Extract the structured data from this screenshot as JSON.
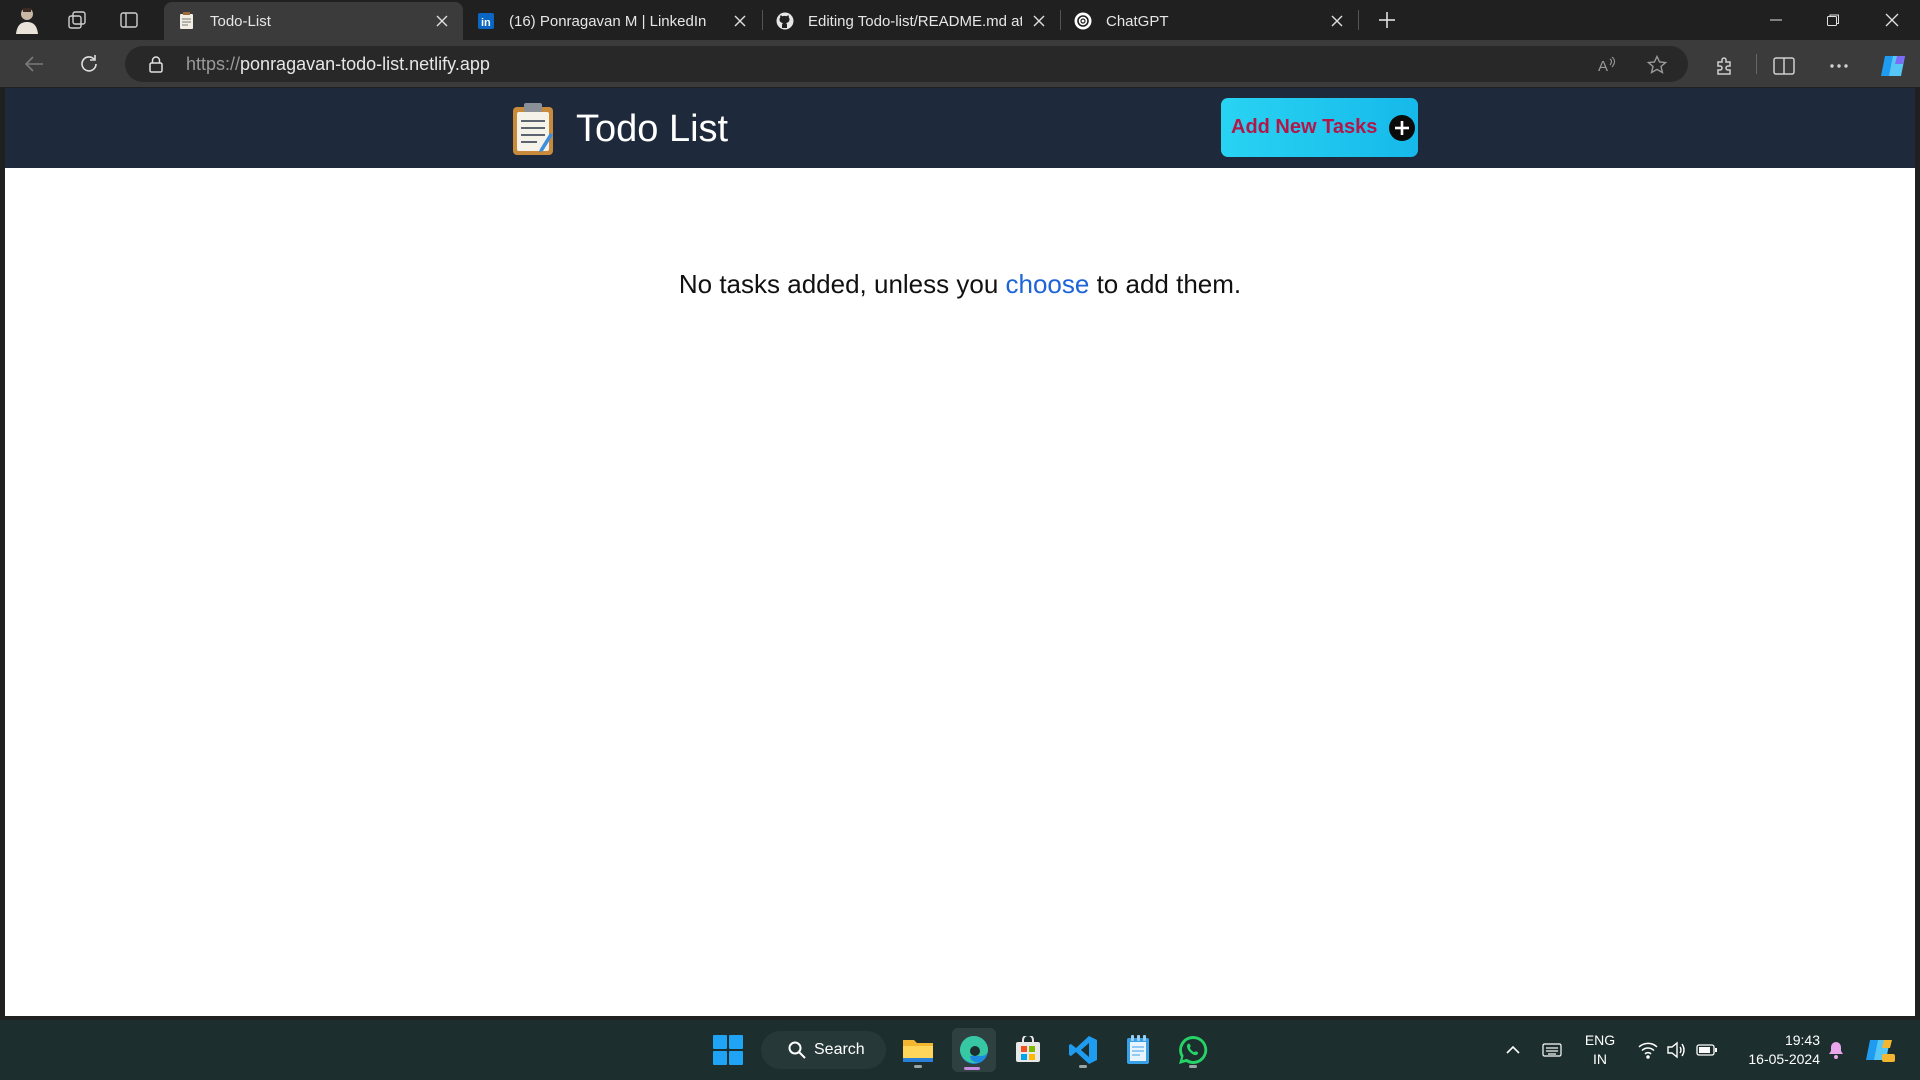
{
  "browser": {
    "tabs": [
      {
        "title": "Todo-List",
        "favicon": "memo-icon",
        "active": true
      },
      {
        "title": "(16) Ponragavan M | LinkedIn",
        "favicon": "linkedin-icon",
        "active": false
      },
      {
        "title": "Editing Todo-list/README.md at",
        "favicon": "github-icon",
        "active": false
      },
      {
        "title": "ChatGPT",
        "favicon": "chatgpt-icon",
        "active": false
      }
    ],
    "url_scheme": "https://",
    "url_host": "ponragavan-todo-list.netlify.app"
  },
  "app": {
    "title": "Todo List",
    "add_button_label": "Add New Tasks",
    "empty_message": {
      "before": "No tasks added, unless you ",
      "link": "choose",
      "after": " to add them."
    },
    "colors": {
      "header_bg": "#1e293b",
      "button_bg": "#29d3f2",
      "button_text": "#b3174a",
      "link": "#1d63d9"
    }
  },
  "taskbar": {
    "search_label": "Search",
    "apps": [
      "windows-start-icon",
      "file-explorer-icon",
      "edge-icon",
      "microsoft-store-icon",
      "vscode-icon",
      "notepad-icon",
      "whatsapp-icon"
    ],
    "language_line1": "ENG",
    "language_line2": "IN",
    "time": "19:43",
    "date": "16-05-2024"
  }
}
